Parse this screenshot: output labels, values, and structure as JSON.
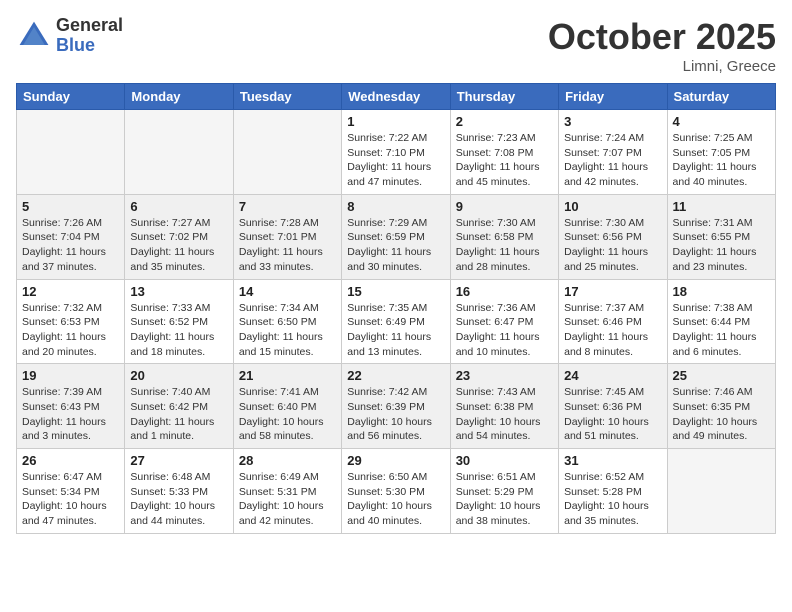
{
  "header": {
    "logo_general": "General",
    "logo_blue": "Blue",
    "month_title": "October 2025",
    "location": "Limni, Greece"
  },
  "days_of_week": [
    "Sunday",
    "Monday",
    "Tuesday",
    "Wednesday",
    "Thursday",
    "Friday",
    "Saturday"
  ],
  "weeks": [
    [
      {
        "num": "",
        "info": ""
      },
      {
        "num": "",
        "info": ""
      },
      {
        "num": "",
        "info": ""
      },
      {
        "num": "1",
        "info": "Sunrise: 7:22 AM\nSunset: 7:10 PM\nDaylight: 11 hours\nand 47 minutes."
      },
      {
        "num": "2",
        "info": "Sunrise: 7:23 AM\nSunset: 7:08 PM\nDaylight: 11 hours\nand 45 minutes."
      },
      {
        "num": "3",
        "info": "Sunrise: 7:24 AM\nSunset: 7:07 PM\nDaylight: 11 hours\nand 42 minutes."
      },
      {
        "num": "4",
        "info": "Sunrise: 7:25 AM\nSunset: 7:05 PM\nDaylight: 11 hours\nand 40 minutes."
      }
    ],
    [
      {
        "num": "5",
        "info": "Sunrise: 7:26 AM\nSunset: 7:04 PM\nDaylight: 11 hours\nand 37 minutes."
      },
      {
        "num": "6",
        "info": "Sunrise: 7:27 AM\nSunset: 7:02 PM\nDaylight: 11 hours\nand 35 minutes."
      },
      {
        "num": "7",
        "info": "Sunrise: 7:28 AM\nSunset: 7:01 PM\nDaylight: 11 hours\nand 33 minutes."
      },
      {
        "num": "8",
        "info": "Sunrise: 7:29 AM\nSunset: 6:59 PM\nDaylight: 11 hours\nand 30 minutes."
      },
      {
        "num": "9",
        "info": "Sunrise: 7:30 AM\nSunset: 6:58 PM\nDaylight: 11 hours\nand 28 minutes."
      },
      {
        "num": "10",
        "info": "Sunrise: 7:30 AM\nSunset: 6:56 PM\nDaylight: 11 hours\nand 25 minutes."
      },
      {
        "num": "11",
        "info": "Sunrise: 7:31 AM\nSunset: 6:55 PM\nDaylight: 11 hours\nand 23 minutes."
      }
    ],
    [
      {
        "num": "12",
        "info": "Sunrise: 7:32 AM\nSunset: 6:53 PM\nDaylight: 11 hours\nand 20 minutes."
      },
      {
        "num": "13",
        "info": "Sunrise: 7:33 AM\nSunset: 6:52 PM\nDaylight: 11 hours\nand 18 minutes."
      },
      {
        "num": "14",
        "info": "Sunrise: 7:34 AM\nSunset: 6:50 PM\nDaylight: 11 hours\nand 15 minutes."
      },
      {
        "num": "15",
        "info": "Sunrise: 7:35 AM\nSunset: 6:49 PM\nDaylight: 11 hours\nand 13 minutes."
      },
      {
        "num": "16",
        "info": "Sunrise: 7:36 AM\nSunset: 6:47 PM\nDaylight: 11 hours\nand 10 minutes."
      },
      {
        "num": "17",
        "info": "Sunrise: 7:37 AM\nSunset: 6:46 PM\nDaylight: 11 hours\nand 8 minutes."
      },
      {
        "num": "18",
        "info": "Sunrise: 7:38 AM\nSunset: 6:44 PM\nDaylight: 11 hours\nand 6 minutes."
      }
    ],
    [
      {
        "num": "19",
        "info": "Sunrise: 7:39 AM\nSunset: 6:43 PM\nDaylight: 11 hours\nand 3 minutes."
      },
      {
        "num": "20",
        "info": "Sunrise: 7:40 AM\nSunset: 6:42 PM\nDaylight: 11 hours\nand 1 minute."
      },
      {
        "num": "21",
        "info": "Sunrise: 7:41 AM\nSunset: 6:40 PM\nDaylight: 10 hours\nand 58 minutes."
      },
      {
        "num": "22",
        "info": "Sunrise: 7:42 AM\nSunset: 6:39 PM\nDaylight: 10 hours\nand 56 minutes."
      },
      {
        "num": "23",
        "info": "Sunrise: 7:43 AM\nSunset: 6:38 PM\nDaylight: 10 hours\nand 54 minutes."
      },
      {
        "num": "24",
        "info": "Sunrise: 7:45 AM\nSunset: 6:36 PM\nDaylight: 10 hours\nand 51 minutes."
      },
      {
        "num": "25",
        "info": "Sunrise: 7:46 AM\nSunset: 6:35 PM\nDaylight: 10 hours\nand 49 minutes."
      }
    ],
    [
      {
        "num": "26",
        "info": "Sunrise: 6:47 AM\nSunset: 5:34 PM\nDaylight: 10 hours\nand 47 minutes."
      },
      {
        "num": "27",
        "info": "Sunrise: 6:48 AM\nSunset: 5:33 PM\nDaylight: 10 hours\nand 44 minutes."
      },
      {
        "num": "28",
        "info": "Sunrise: 6:49 AM\nSunset: 5:31 PM\nDaylight: 10 hours\nand 42 minutes."
      },
      {
        "num": "29",
        "info": "Sunrise: 6:50 AM\nSunset: 5:30 PM\nDaylight: 10 hours\nand 40 minutes."
      },
      {
        "num": "30",
        "info": "Sunrise: 6:51 AM\nSunset: 5:29 PM\nDaylight: 10 hours\nand 38 minutes."
      },
      {
        "num": "31",
        "info": "Sunrise: 6:52 AM\nSunset: 5:28 PM\nDaylight: 10 hours\nand 35 minutes."
      },
      {
        "num": "",
        "info": ""
      }
    ]
  ]
}
